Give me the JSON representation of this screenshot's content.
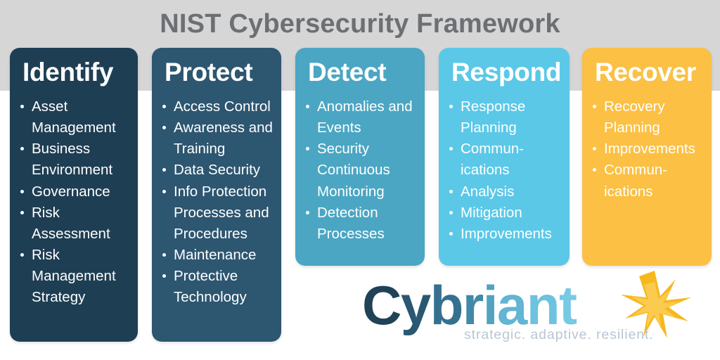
{
  "header": {
    "title": "NIST Cybersecurity Framework",
    "band_color": "#d6d6d6",
    "title_color": "#6c7074"
  },
  "cards": [
    {
      "id": "identify",
      "title": "Identify",
      "color": "#1e3e53",
      "items": [
        "Asset Management",
        "Business Environment",
        "Governance",
        "Risk Assessment",
        "Risk Management Strategy"
      ]
    },
    {
      "id": "protect",
      "title": "Protect",
      "color": "#2d5670",
      "items": [
        "Access Control",
        "Awareness and Training",
        "Data Security",
        "Info Protection Processes and Procedures",
        "Maintenance",
        "Protective Technology"
      ]
    },
    {
      "id": "detect",
      "title": "Detect",
      "color": "#4ba6c3",
      "items": [
        "Anomalies and Events",
        "Security Continuous Monitoring",
        "Detection Processes"
      ]
    },
    {
      "id": "respond",
      "title": "Respond",
      "color": "#5bc8e8",
      "items": [
        "Response Planning",
        "Commun-ications",
        "Analysis",
        "Mitigation",
        "Improvements"
      ]
    },
    {
      "id": "recover",
      "title": "Recover",
      "color": "#fbc044",
      "items": [
        "Recovery Planning",
        "Improvements",
        "Commun-ications"
      ]
    }
  ],
  "logo": {
    "wordmark": "Cybriant",
    "letters": [
      "C",
      "y",
      "b",
      "r",
      "i",
      "a",
      "n",
      "t"
    ],
    "tagline": "strategic. adaptive. resilient.",
    "tagline_color": "#b9c6d2",
    "star_color": "#f5b921",
    "star_color_light": "#fbcf55",
    "icon": "starburst-icon"
  }
}
